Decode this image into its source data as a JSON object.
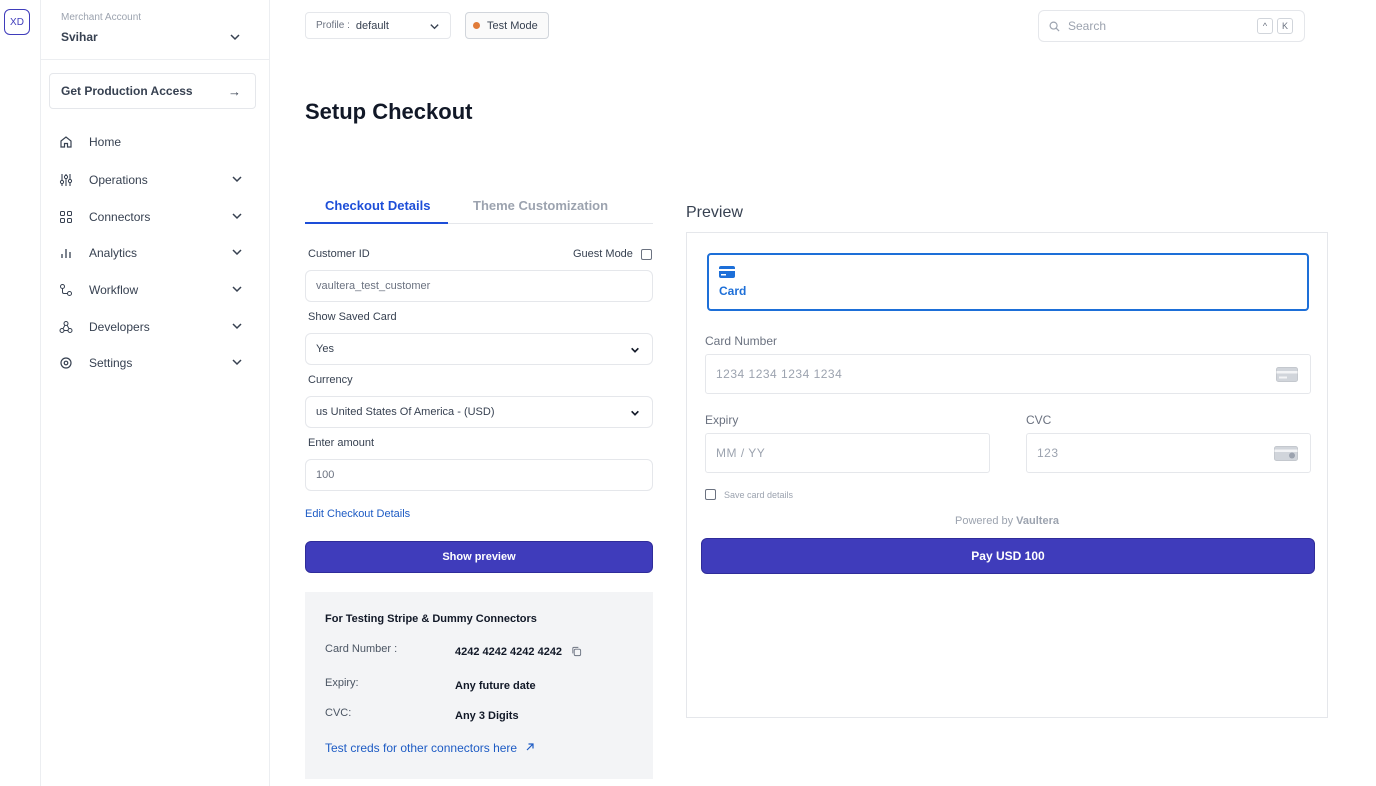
{
  "rail": {
    "avatar": "XD"
  },
  "sidebar": {
    "merchant_label": "Merchant Account",
    "merchant_name": "Svihar",
    "production_access": "Get Production Access",
    "items": [
      {
        "label": "Home",
        "icon": "home-icon"
      },
      {
        "label": "Operations",
        "icon": "operations-icon"
      },
      {
        "label": "Connectors",
        "icon": "connectors-icon"
      },
      {
        "label": "Analytics",
        "icon": "analytics-icon"
      },
      {
        "label": "Workflow",
        "icon": "workflow-icon"
      },
      {
        "label": "Developers",
        "icon": "developers-icon"
      },
      {
        "label": "Settings",
        "icon": "settings-icon"
      }
    ]
  },
  "topbar": {
    "profile_label": "Profile :",
    "profile_value": "default",
    "test_mode": "Test Mode",
    "search_placeholder": "Search",
    "kbd_1": "^",
    "kbd_2": "K"
  },
  "page": {
    "title": "Setup Checkout"
  },
  "tabs": {
    "active": "Checkout Details",
    "inactive": "Theme Customization"
  },
  "form": {
    "customer_id_label": "Customer ID",
    "guest_mode_label": "Guest Mode",
    "customer_id_value": "vaultera_test_customer",
    "saved_card_label": "Show Saved Card",
    "saved_card_value": "Yes",
    "currency_label": "Currency",
    "currency_value": "us United States Of America - (USD)",
    "amount_label": "Enter amount",
    "amount_value": "100",
    "edit_link": "Edit Checkout Details",
    "show_preview": "Show preview"
  },
  "testing": {
    "title": "For Testing Stripe & Dummy Connectors",
    "card_number_key": "Card Number :",
    "card_number_val": "4242 4242 4242 4242",
    "expiry_key": "Expiry:",
    "expiry_val": "Any future date",
    "cvc_key": "CVC:",
    "cvc_val": "Any 3 Digits",
    "link": "Test creds for other connectors here"
  },
  "preview": {
    "title": "Preview",
    "card_tab": "Card",
    "card_number_label": "Card Number",
    "card_number_placeholder": "1234 1234 1234 1234",
    "expiry_label": "Expiry",
    "expiry_placeholder": "MM / YY",
    "cvc_label": "CVC",
    "cvc_placeholder": "123",
    "save_card": "Save card details",
    "powered_prefix": "Powered by",
    "powered_brand": "Vaultera",
    "pay_button": "Pay USD 100"
  },
  "colors": {
    "accent": "#3f3cbb",
    "link": "#1d5bc4",
    "card_tab": "#1d6fd8",
    "test_mode_dot": "#e07b39"
  }
}
